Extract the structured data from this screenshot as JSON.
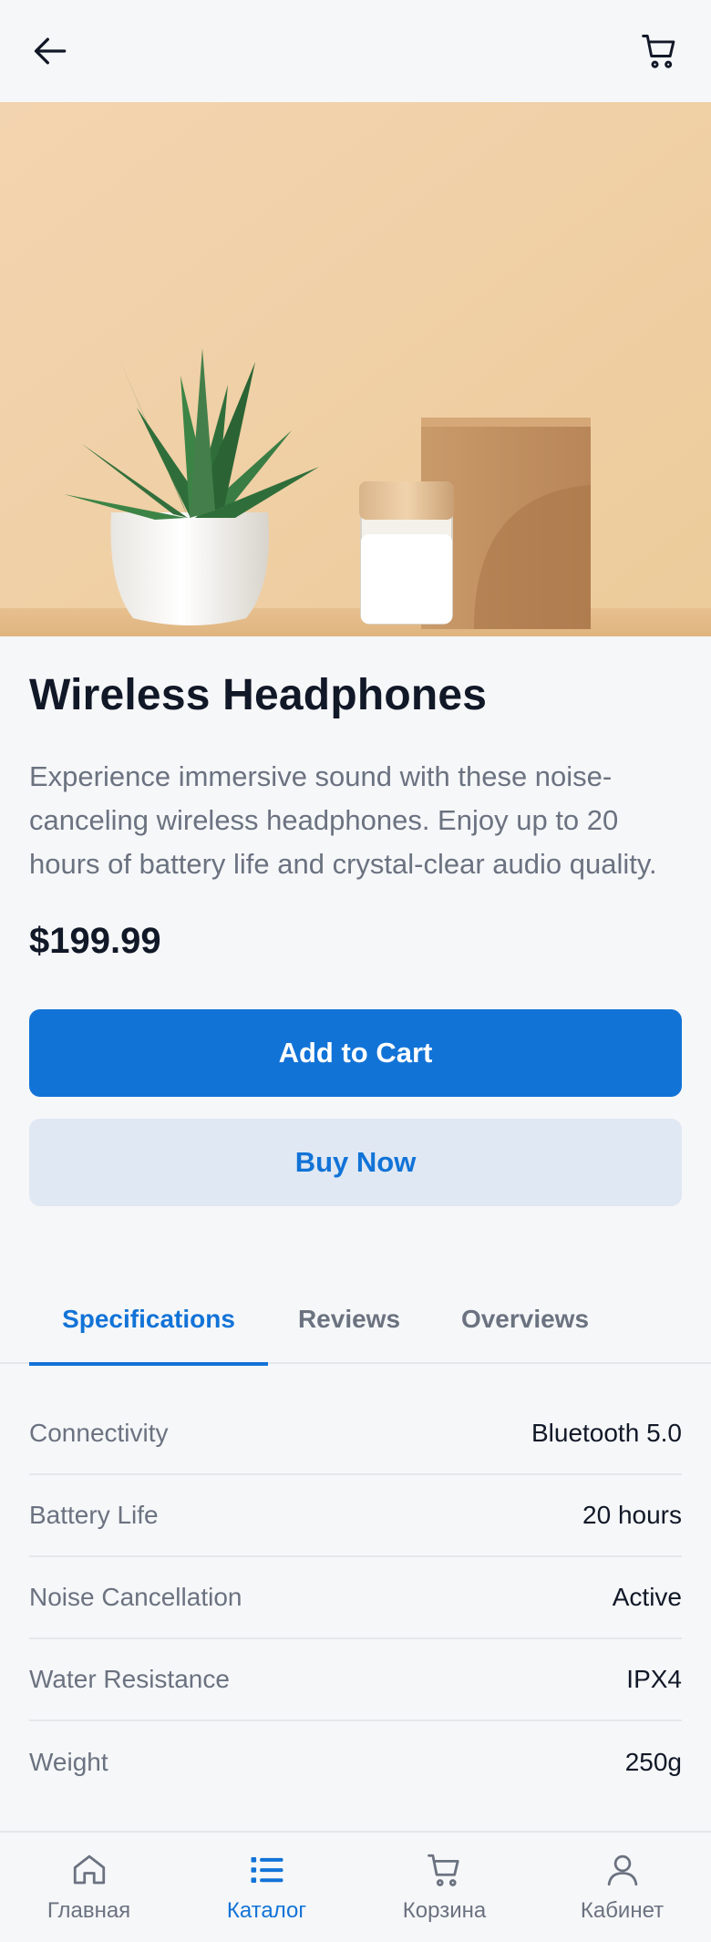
{
  "header": {
    "back_icon": "back-arrow-icon",
    "cart_icon": "cart-icon"
  },
  "product": {
    "title": "Wireless Headphones",
    "description": "Experience immersive sound with these noise-canceling wireless headphones. Enjoy up to 20 hours of battery life and crystal-clear audio quality.",
    "price": "$199.99"
  },
  "actions": {
    "add_to_cart": "Add to Cart",
    "buy_now": "Buy Now"
  },
  "tabs": [
    {
      "label": "Specifications",
      "active": true
    },
    {
      "label": "Reviews",
      "active": false
    },
    {
      "label": "Overviews",
      "active": false
    }
  ],
  "specs": [
    {
      "label": "Connectivity",
      "value": "Bluetooth 5.0"
    },
    {
      "label": "Battery Life",
      "value": "20 hours"
    },
    {
      "label": "Noise Cancellation",
      "value": "Active"
    },
    {
      "label": "Water Resistance",
      "value": "IPX4"
    },
    {
      "label": "Weight",
      "value": "250g"
    }
  ],
  "nav": [
    {
      "label": "Главная",
      "icon": "home-icon",
      "active": false
    },
    {
      "label": "Каталог",
      "icon": "list-icon",
      "active": true
    },
    {
      "label": "Корзина",
      "icon": "cart-icon",
      "active": false
    },
    {
      "label": "Кабинет",
      "icon": "user-icon",
      "active": false
    }
  ],
  "colors": {
    "accent": "#1273d7",
    "secondary_button_bg": "#dfe8f3",
    "background": "#f6f7f9",
    "muted_text": "#6b7280"
  }
}
